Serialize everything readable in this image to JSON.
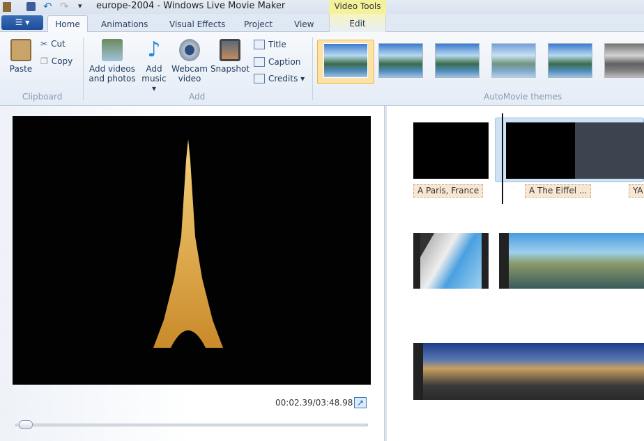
{
  "window": {
    "title": "europe-2004 - Windows Live Movie Maker",
    "context_tab_group": "Video Tools"
  },
  "tabs": [
    "Home",
    "Animations",
    "Visual Effects",
    "Project",
    "View",
    "Edit"
  ],
  "active_tab": "Home",
  "ribbon": {
    "clipboard": {
      "label": "Clipboard",
      "paste": "Paste",
      "cut": "Cut",
      "copy": "Copy"
    },
    "add": {
      "label": "Add",
      "add_videos": [
        "Add videos",
        "and photos"
      ],
      "add_music": [
        "Add",
        "music ▾"
      ],
      "webcam": [
        "Webcam",
        "video"
      ],
      "snapshot": "Snapshot",
      "title": "Title",
      "caption": "Caption",
      "credits": "Credits ▾"
    },
    "themes": {
      "label": "AutoMovie themes",
      "count": 6,
      "selected": 1
    }
  },
  "preview": {
    "time": "00:02.39/03:48.98",
    "progress": 0.01
  },
  "storyboard": {
    "captions": [
      "A Paris, France",
      "A The Eiffel ...",
      "YA"
    ]
  },
  "colors": {
    "accent": "#1d4d9a",
    "selected_theme": "#f2b64a",
    "caption_bg": "#f7e6d2"
  }
}
